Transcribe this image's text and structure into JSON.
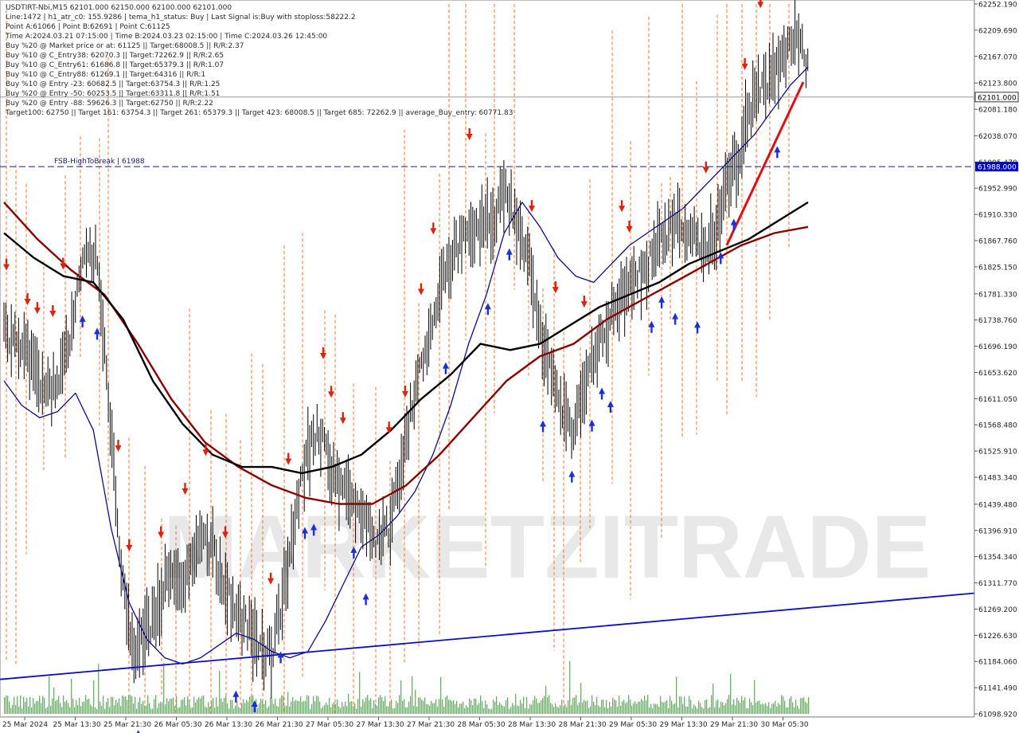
{
  "header": {
    "lines": [
      "USDTIRT-Nbi,M15  62101.000 62150.000 62100.000 62101.000",
      "Line:1472 | h1_atr_c0: 155.9286 | tema_h1_status: Buy | Last Signal is:Buy with stoploss:58222.2",
      "Point A:61066 | Point B:62691 | Point C:61125",
      "Time A:2024.03.21 07:15:00 | Time B:2024.03.23 02:15:00 | Time C:2024.03.26 12:45:00",
      "Buy %20 @ Market price or at: 61125 || Target:68008.5 || R/R:2.37",
      "Buy %10 @ C_Entry38: 62070.3 || Target:72262.9 || R/R:2.65",
      "Buy %10 @ C_Entry61: 61686.8 || Target:65379.3 || R/R:1.07",
      "Buy %10 @ C_Entry88: 61269.1 || Target:64316 || R/R:1",
      "Buy %10 @ Entry -23: 60682.5 || Target:63754.3 || R/R:1.25",
      "Buy %20 @ Entry -50: 60253.5 || Target:63311.8 || R/R:1.51",
      "Buy %20 @ Entry -88: 59626.3 || Target:62750 || R/R:2.22",
      "Target100: 62750 || Target 161: 63754.3 || Target 261: 65379.3 || Target 423: 68008.5 || Target 685: 72262.9 || average_Buy_entry: 60771.83"
    ]
  },
  "fsb_label": "FSB-HighToBreak | 61988",
  "watermark": "MARKETZITRADE",
  "chart_data": {
    "type": "line",
    "title": "USDTIRT-Nbi,M15",
    "ylim": [
      61098.92,
      62252.19
    ],
    "y_ticks": [
      "62252.190",
      "62209.690",
      "62167.070",
      "62123.800",
      "62081.180",
      "62038.070",
      "61995.470",
      "61952.990",
      "61910.330",
      "61867.760",
      "61825.150",
      "61781.330",
      "61738.760",
      "61696.190",
      "61653.620",
      "61611.050",
      "61568.480",
      "61525.910",
      "61483.340",
      "61439.480",
      "61396.910",
      "61354.340",
      "61311.770",
      "61269.200",
      "61226.630",
      "61184.060",
      "61141.490",
      "61098.920"
    ],
    "x_ticks": [
      "25 Mar 2024",
      "25 Mar 13:30",
      "25 Mar 21:30",
      "26 Mar 05:30",
      "26 Mar 13:30",
      "26 Mar 21:30",
      "27 Mar 05:30",
      "27 Mar 13:30",
      "27 Mar 21:30",
      "28 Mar 05:30",
      "28 Mar 13:30",
      "28 Mar 21:30",
      "29 Mar 05:30",
      "29 Mar 13:30",
      "29 Mar 21:30",
      "30 Mar 05:30"
    ],
    "current_price": "62101.000",
    "fsb_level": 61988,
    "fsb_tag": "61988.000",
    "close_series": [
      61720,
      61700,
      61680,
      61640,
      61620,
      61660,
      61740,
      61860,
      61840,
      61600,
      61350,
      61200,
      61230,
      61260,
      61320,
      61300,
      61340,
      61380,
      61360,
      61300,
      61260,
      61240,
      61200,
      61200,
      61300,
      61420,
      61520,
      61560,
      61500,
      61460,
      61440,
      61420,
      61380,
      61400,
      61480,
      61600,
      61680,
      61760,
      61820,
      61860,
      61880,
      61900,
      61900,
      61960,
      61900,
      61840,
      61720,
      61660,
      61580,
      61560,
      61640,
      61700,
      61740,
      61780,
      61800,
      61820,
      61860,
      61880,
      61900,
      61880,
      61860,
      61880,
      61960,
      62000,
      62080,
      62120,
      62140,
      62160,
      62200,
      62150
    ],
    "ema_fast_blue": [
      61640,
      61600,
      61580,
      61590,
      61620,
      61560,
      61400,
      61280,
      61220,
      61190,
      61180,
      61190,
      61210,
      61230,
      61220,
      61200,
      61190,
      61200,
      61250,
      61310,
      61370,
      61390,
      61420,
      61460,
      61520,
      61600,
      61700,
      61780,
      61880,
      61930,
      61890,
      61840,
      61810,
      61800,
      61830,
      61860,
      61880,
      61900,
      61920,
      61950,
      61980,
      62010,
      62040,
      62080,
      62120,
      62150
    ],
    "ma_mid_black": [
      61880,
      61840,
      61810,
      61800,
      61740,
      61640,
      61570,
      61520,
      61500,
      61500,
      61490,
      61500,
      61520,
      61560,
      61610,
      61650,
      61700,
      61690,
      61700,
      61730,
      61760,
      61780,
      61800,
      61830,
      61850,
      61870,
      61900,
      61930
    ],
    "ma_slow_red": [
      61930,
      61870,
      61820,
      61780,
      61700,
      61610,
      61540,
      61500,
      61470,
      61450,
      61440,
      61440,
      61470,
      61520,
      61580,
      61640,
      61680,
      61700,
      61740,
      61770,
      61800,
      61830,
      61860,
      61880,
      61890
    ],
    "trendline_blue": [
      61155,
      61295
    ],
    "colors": {
      "candles": "#000000",
      "ema_fast": "#0b0b8c",
      "ma_mid": "#000000",
      "ma_slow": "#8b0000",
      "trendline": "#0b0bd0",
      "fsb_line": "#1a1a8a",
      "fsb_tag_bg": "#0000cc",
      "price_tag_bg": "#ffffff",
      "volume": "#3ccf3c",
      "signals_buy": "#1a2fd6",
      "signals_sell": "#e0210c",
      "fractal_orange": "#ff5a00",
      "watermark": "#e8e8e8"
    }
  }
}
